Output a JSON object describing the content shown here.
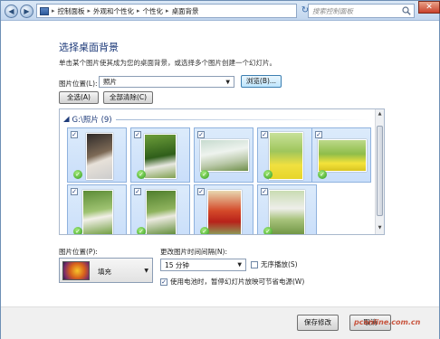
{
  "address_bar": {
    "breadcrumbs": [
      "控制面板",
      "外观和个性化",
      "个性化",
      "桌面背景"
    ],
    "search_placeholder": "搜索控制面板"
  },
  "page": {
    "title": "选择桌面背景",
    "subtitle": "单击某个图片使其成为您的桌面背景，或选择多个图片创建一个幻灯片。"
  },
  "picture_location": {
    "label": "图片位置(L):",
    "value": "照片",
    "browse_label": "浏览(B)..."
  },
  "actions": {
    "select_all": "全选(A)",
    "clear_all": "全部清除(C)"
  },
  "gallery": {
    "group_title": "G:\\照片 (9)",
    "items": [
      {
        "checked": true
      },
      {
        "checked": true
      },
      {
        "checked": true
      },
      {
        "checked": true
      },
      {
        "checked": true
      },
      {
        "checked": true
      },
      {
        "checked": true
      },
      {
        "checked": true
      },
      {
        "checked": true
      }
    ]
  },
  "position": {
    "label": "图片位置(P):",
    "value": "填充"
  },
  "interval": {
    "label": "更改图片时间间隔(N):",
    "value": "15 分钟",
    "shuffle_label": "无序播放(S)",
    "shuffle_checked": false,
    "battery_label": "使用电池时，暂停幻灯片放映可节省电源(W)",
    "battery_checked": true
  },
  "footer": {
    "save_label": "保存修改",
    "cancel_label": "取消",
    "watermark": "pconline.com.cn"
  }
}
